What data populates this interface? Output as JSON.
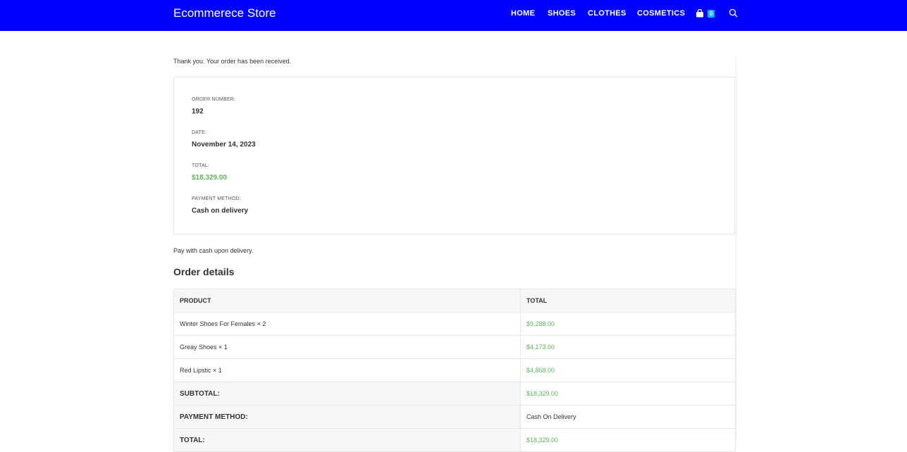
{
  "header": {
    "brand": "Ecommerece Store",
    "nav": [
      "HOME",
      "SHOES",
      "CLOTHES",
      "COSMETICS"
    ],
    "cart_count": "0",
    "colors": {
      "bar": "#0000ff",
      "badge": "#13aff0",
      "price": "#5cb85c"
    }
  },
  "main": {
    "thankyou": "Thank you. Your order has been received.",
    "overview": [
      {
        "label": "ORDER NUMBER:",
        "value": "192"
      },
      {
        "label": "DATE:",
        "value": "November 14, 2023"
      },
      {
        "label": "TOTAL:",
        "value": "$18,329.00"
      },
      {
        "label": "PAYMENT METHOD:",
        "value": "Cash on delivery"
      }
    ],
    "pay_note": "Pay with cash upon delivery.",
    "details_title": "Order details",
    "table": {
      "headers": [
        "PRODUCT",
        "TOTAL"
      ],
      "rows": [
        {
          "product": "Winter Shoes For Females",
          "qty": "× 2",
          "total": "$9,288.00"
        },
        {
          "product": "Greay Shoes",
          "qty": "× 1",
          "total": "$4,173.00"
        },
        {
          "product": "Red Lipstic",
          "qty": "× 1",
          "total": "$4,868.00"
        }
      ],
      "footer": [
        {
          "label": "SUBTOTAL:",
          "value": "$18,329.00"
        },
        {
          "label": "PAYMENT METHOD:",
          "value": "Cash On Delivery"
        },
        {
          "label": "TOTAL:",
          "value": "$18,329.00"
        }
      ]
    }
  }
}
